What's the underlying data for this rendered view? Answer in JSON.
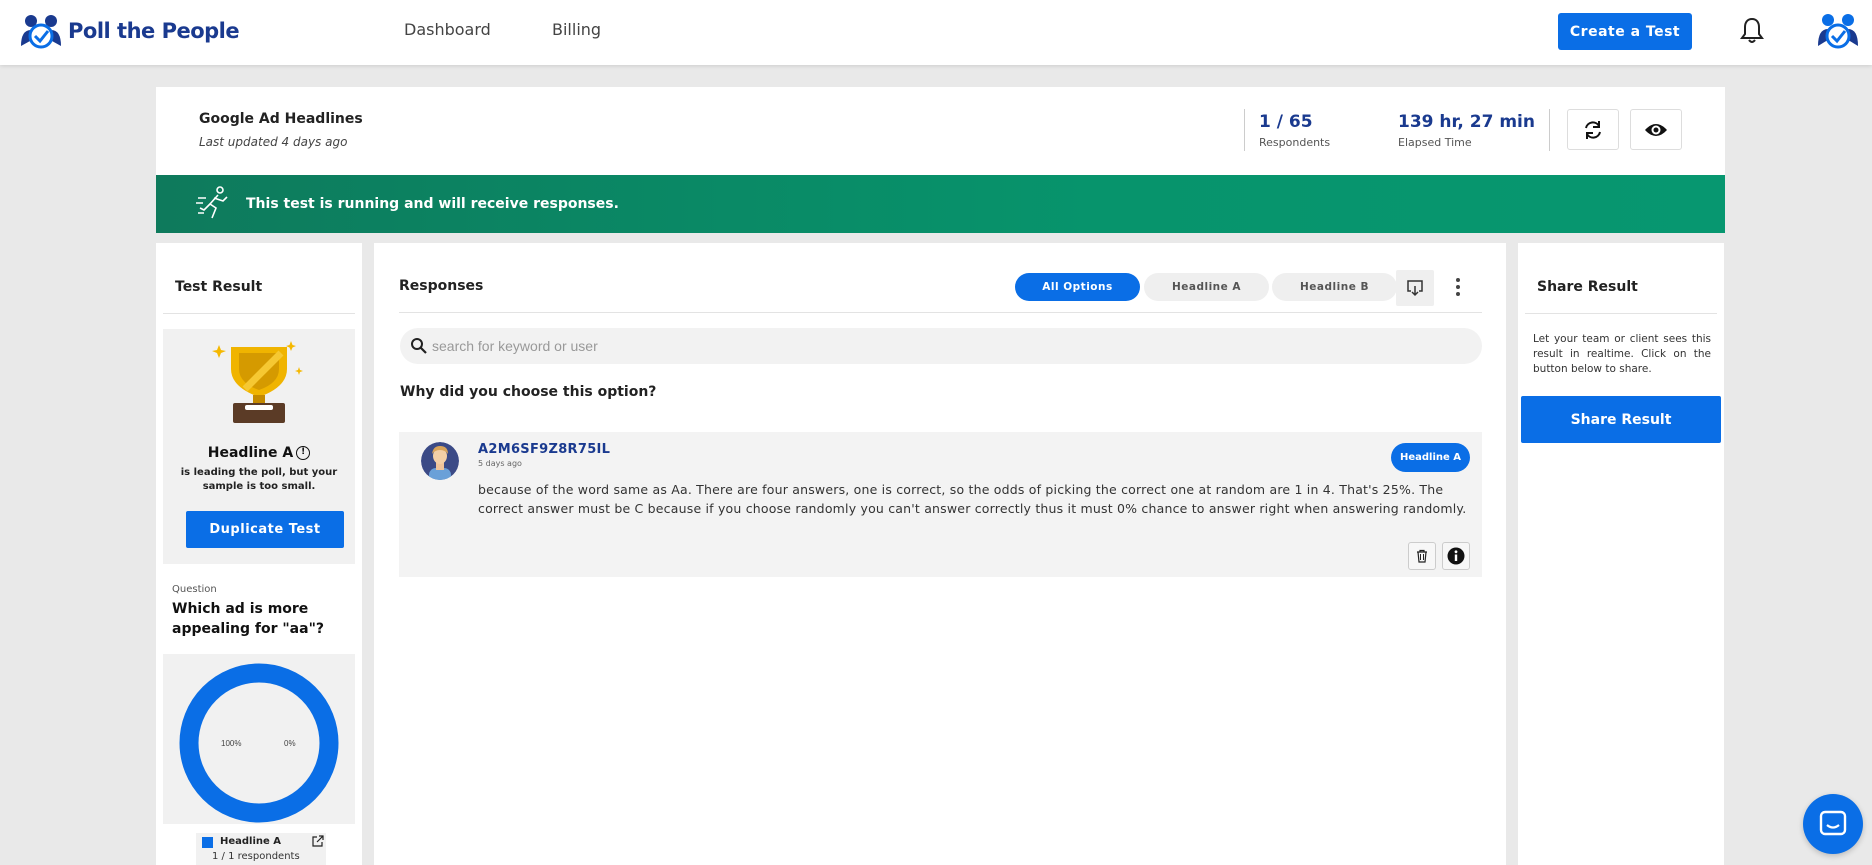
{
  "nav": {
    "brand": "Poll the People",
    "links": [
      "Dashboard",
      "Billing"
    ],
    "create_label": "Create a Test"
  },
  "header": {
    "title": "Google Ad Headlines",
    "updated": "Last updated 4 days ago",
    "respondents_value": "1 / 65",
    "respondents_label": "Respondents",
    "elapsed_value": "139 hr, 27 min",
    "elapsed_label": "Elapsed Time"
  },
  "banner": {
    "text": "This test is running and will receive responses."
  },
  "left": {
    "title": "Test Result",
    "winner": "Headline A",
    "winner_sub": "is leading the poll, but your sample is too small.",
    "duplicate_label": "Duplicate Test",
    "question_label": "Question",
    "question_text": "Which ad is more appealing for \"aa\"?",
    "donut_left_label": "100%",
    "donut_right_label": "0%",
    "legend_name": "Headline A",
    "legend_count": "1 / 1 respondents"
  },
  "chart_data": {
    "type": "pie",
    "categories": [
      "Headline A",
      "Headline B"
    ],
    "values": [
      100,
      0
    ],
    "colors": [
      "#0a6ee6",
      "#e0e0e0"
    ]
  },
  "center": {
    "title": "Responses",
    "filters": [
      "All Options",
      "Headline A",
      "Headline B"
    ],
    "active_filter": "All Options",
    "search_placeholder": "search for keyword or user",
    "question": "Why did you choose this option?",
    "response": {
      "user": "A2M6SF9Z8R75IL",
      "time": "5 days ago",
      "tag": "Headline A",
      "text": "because of the word same as Aa. There are four answers, one is correct, so the odds of picking the correct one at random are 1 in 4. That's 25%. The correct answer must be C because if you choose randomly you can't answer correctly thus it must 0% chance to answer right when answering randomly."
    }
  },
  "right": {
    "title": "Share Result",
    "description": "Let your team or client sees this result in realtime. Click on the button below to share.",
    "button_label": "Share Result"
  },
  "colors": {
    "accent": "#0a6ee6",
    "brand_dark": "#1a3a8f",
    "banner": "#079770"
  },
  "icons": [
    "logo-icon",
    "bell-icon",
    "user-avatar-icon",
    "refresh-icon",
    "eye-icon",
    "runner-icon",
    "trophy-icon",
    "info-icon",
    "download-icon",
    "more-vertical-icon",
    "search-icon",
    "trash-icon",
    "info-filled-icon",
    "external-link-icon",
    "chat-icon"
  ]
}
